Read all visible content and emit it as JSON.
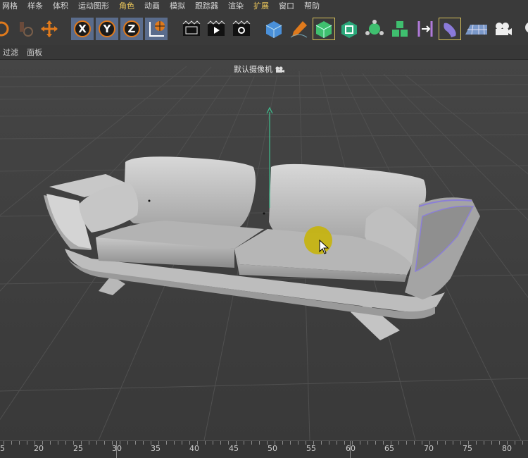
{
  "menu": [
    "网格",
    "样条",
    "体积",
    "运动图形",
    "角色",
    "动画",
    "模拟",
    "跟踪器",
    "渲染",
    "扩展",
    "窗口",
    "帮助"
  ],
  "subbar": {
    "filter_label": "过滤",
    "panel_label": "面板"
  },
  "viewport": {
    "camera_label": "默认摄像机"
  },
  "timeline": {
    "ticks": [
      "5",
      "20",
      "25",
      "30",
      "35",
      "40",
      "45",
      "50",
      "55",
      "60",
      "65",
      "70",
      "75",
      "80"
    ]
  },
  "icons": {
    "move": "move-icon",
    "x_axis": "X",
    "y_axis": "Y",
    "z_axis": "Z",
    "world": "world-coordinates-icon",
    "render_region": "render-region-icon",
    "render_view": "render-view-icon",
    "render_settings": "render-settings-icon",
    "cube": "cube-icon",
    "pen": "pen-icon",
    "subdivision": "subdivision-icon",
    "cloner": "cloner-icon",
    "generator": "generator-icon",
    "mograph": "mograph-icon",
    "deformer": "deformer-icon",
    "bend": "bend-icon",
    "floor": "floor-icon",
    "camera": "camera-icon",
    "light": "light-icon"
  },
  "colors": {
    "accent_axis": "#e07a1c",
    "active_bg": "#5a6c8c",
    "cursor_highlight": "#c8b400",
    "y_axis_line": "#3fbf8f"
  }
}
